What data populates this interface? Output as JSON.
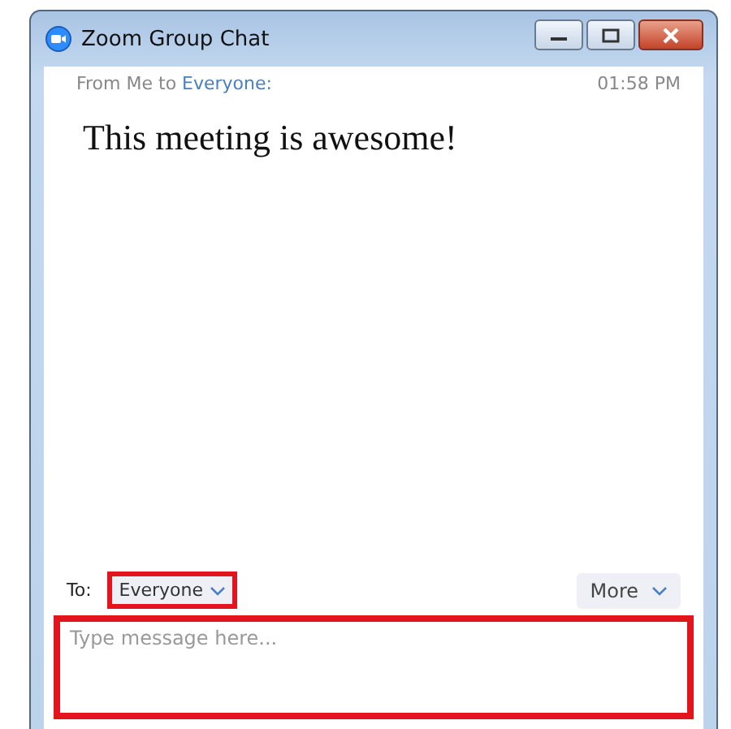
{
  "window": {
    "title": "Zoom Group Chat"
  },
  "messages": [
    {
      "from_prefix": "From Me to",
      "recipient": "Everyone:",
      "time": "01:58 PM",
      "text": "This meeting is awesome!"
    }
  ],
  "to": {
    "label": "To:",
    "value": "Everyone"
  },
  "more_button": {
    "label": "More"
  },
  "message_input": {
    "placeholder": "Type message here..."
  }
}
